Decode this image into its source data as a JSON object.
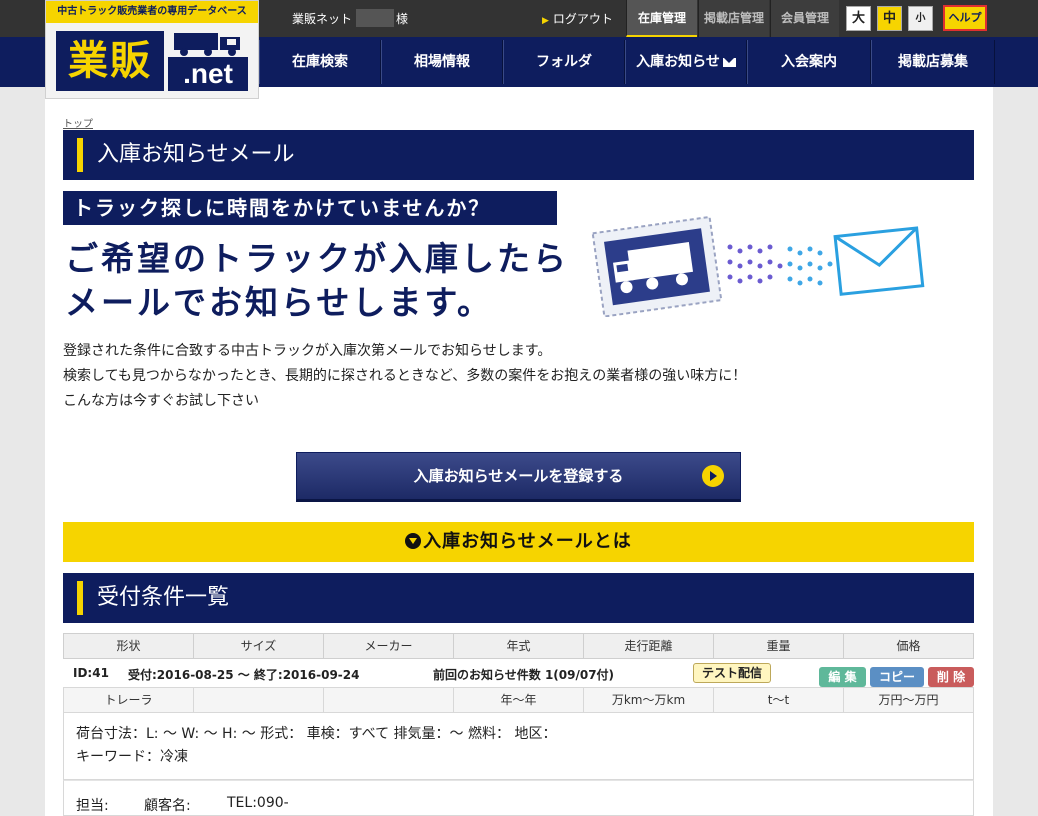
{
  "header": {
    "logo_tagline": "中古トラック販売業者の専用データベース",
    "logo_kanji": "業販",
    "logo_net": ".net",
    "user_label": "業販ネット",
    "user_suffix": "様",
    "logout": "ログアウト",
    "top_tabs": [
      "在庫管理",
      "掲載店管理",
      "会員管理"
    ],
    "font_sizes": [
      "大",
      "中",
      "小"
    ],
    "help": "ヘルプ"
  },
  "nav": {
    "items": [
      "在庫検索",
      "相場情報",
      "フォルダ",
      "入庫お知らせ",
      "入会案内",
      "掲載店募集"
    ]
  },
  "breadcrumb": "トップ",
  "page_title": "入庫お知らせメール",
  "promo": {
    "catch": "トラック探しに時間をかけていませんか？",
    "big_line1": "ご希望のトラックが入庫したら",
    "big_line2": "メールでお知らせします。"
  },
  "description": [
    "登録された条件に合致する中古トラックが入庫次第メールでお知らせします。",
    "検索しても見つからなかったとき、長期的に探されるときなど、多数の案件をお抱えの業者様の強い味方に！",
    "こんな方は今すぐお試し下さい"
  ],
  "register_button": "入庫お知らせメールを登録する",
  "about_label": "入庫お知らせメールとは",
  "conditions_title": "受付条件一覧",
  "table": {
    "headers": [
      "形状",
      "サイズ",
      "メーカー",
      "年式",
      "走行距離",
      "重量",
      "価格"
    ],
    "record": {
      "id": "ID:41",
      "dates": "受付:2016-08-25 〜 終了:2016-09-24",
      "last_notice": "前回のお知らせ件数 1(09/07付)",
      "test_button": "テスト配信",
      "edit": "編 集",
      "copy": "コピー",
      "delete": "削 除",
      "values": [
        "トレーラ",
        "",
        "",
        "年〜年",
        "万km〜万km",
        "t〜t",
        "万円〜万円"
      ],
      "detail_line1": "荷台寸法：L: 〜 W: 〜 H: 〜 形式： 車検：すべて 排気量：〜 燃料： 地区：",
      "detail_line2": "キーワード：冷凍",
      "contact_person": "担当:",
      "customer_name": "顧客名:",
      "tel": "TEL:090-"
    }
  },
  "colors": {
    "navy": "#0e1d5e",
    "yellow": "#f6d400",
    "topbar": "#333333"
  }
}
